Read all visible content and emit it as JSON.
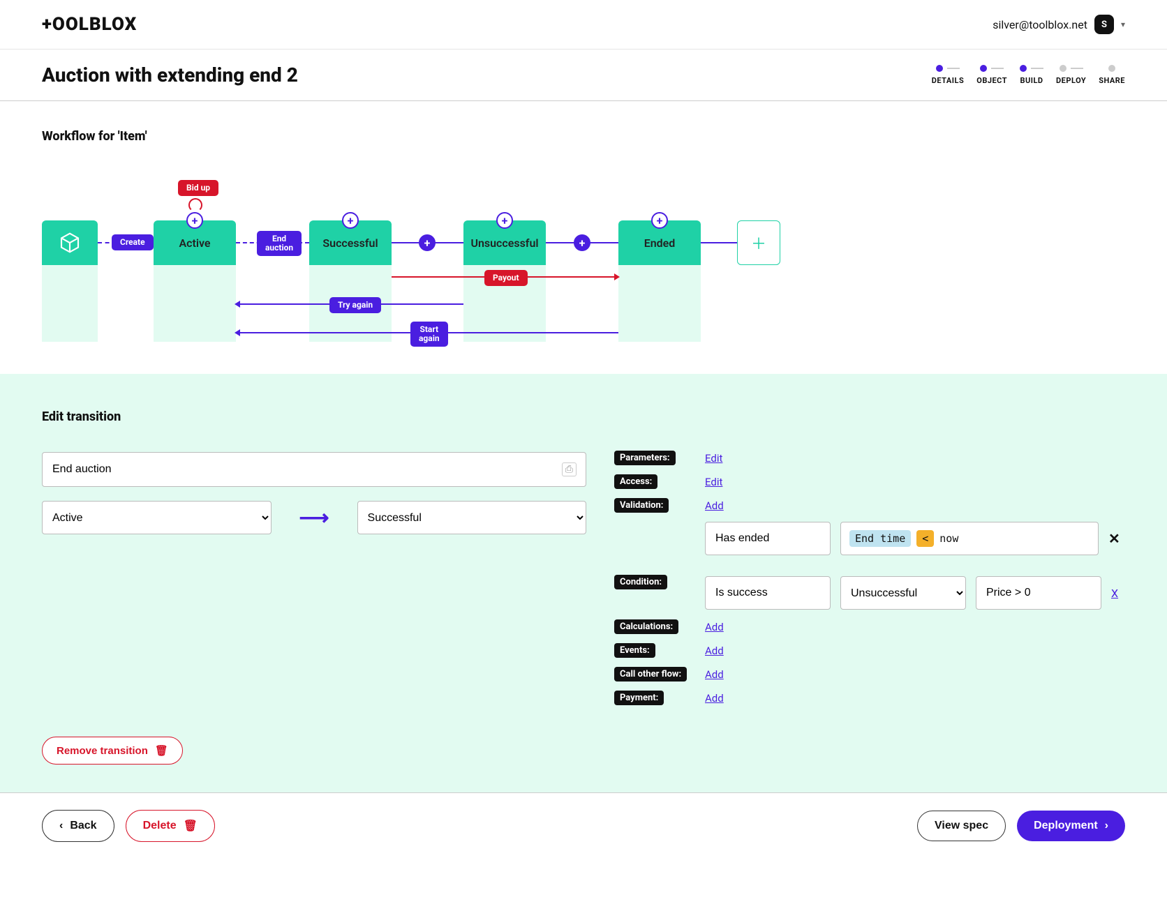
{
  "brand": "+OOLBLOX",
  "user": {
    "email": "silver@toolblox.net",
    "initial": "S"
  },
  "pageTitle": "Auction with extending end 2",
  "steps": [
    {
      "label": "DETAILS",
      "on": true
    },
    {
      "label": "OBJECT",
      "on": true
    },
    {
      "label": "BUILD",
      "on": true
    },
    {
      "label": "DEPLOY",
      "on": false
    },
    {
      "label": "SHARE",
      "on": false
    }
  ],
  "workflow": {
    "title": "Workflow for 'Item'",
    "states": [
      "Active",
      "Successful",
      "Unsuccessful",
      "Ended"
    ],
    "transitions": {
      "create": "Create",
      "bidup": "Bid up",
      "endAuction": "End\nauction",
      "payout": "Payout",
      "tryAgain": "Try again",
      "startAgain": "Start\nagain"
    }
  },
  "edit": {
    "title": "Edit transition",
    "name": "End auction",
    "from": "Active",
    "to": "Successful",
    "labels": {
      "parameters": "Parameters:",
      "access": "Access:",
      "validation": "Validation:",
      "condition": "Condition:",
      "calculations": "Calculations:",
      "events": "Events:",
      "callOther": "Call other flow:",
      "payment": "Payment:"
    },
    "links": {
      "edit": "Edit",
      "add": "Add"
    },
    "validation": {
      "name": "Has ended",
      "expr": {
        "a": "End time",
        "op": "<",
        "b": "now"
      }
    },
    "condition": {
      "name": "Is success",
      "target": "Unsuccessful",
      "expr": "Price > 0"
    },
    "removeLabel": "Remove transition"
  },
  "footer": {
    "back": "Back",
    "delete": "Delete",
    "viewSpec": "View spec",
    "deployment": "Deployment"
  }
}
